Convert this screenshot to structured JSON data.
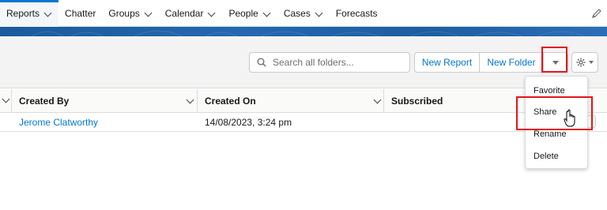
{
  "nav": {
    "items": [
      {
        "label": "Reports",
        "has_menu": true,
        "active": true
      },
      {
        "label": "Chatter",
        "has_menu": false
      },
      {
        "label": "Groups",
        "has_menu": true
      },
      {
        "label": "Calendar",
        "has_menu": true
      },
      {
        "label": "People",
        "has_menu": true
      },
      {
        "label": "Cases",
        "has_menu": true
      },
      {
        "label": "Forecasts",
        "has_menu": false
      }
    ],
    "edit_icon": "pencil-icon"
  },
  "toolbar": {
    "search_placeholder": "Search all folders...",
    "new_report_label": "New Report",
    "new_folder_label": "New Folder",
    "dropdown_icon": "caret-down-icon",
    "settings_icon": "gear-icon"
  },
  "table": {
    "columns": [
      "Created By",
      "Created On",
      "Subscribed"
    ],
    "rows": [
      {
        "created_by": "Jerome Clatworthy",
        "created_on": "14/08/2023, 3:24 pm",
        "subscribed": ""
      }
    ]
  },
  "menu": {
    "items": [
      "Favorite",
      "Share",
      "Rename",
      "Delete"
    ]
  },
  "colors": {
    "accent": "#0176d3",
    "highlight": "#e3151a",
    "banner": "#1b5a9c"
  }
}
